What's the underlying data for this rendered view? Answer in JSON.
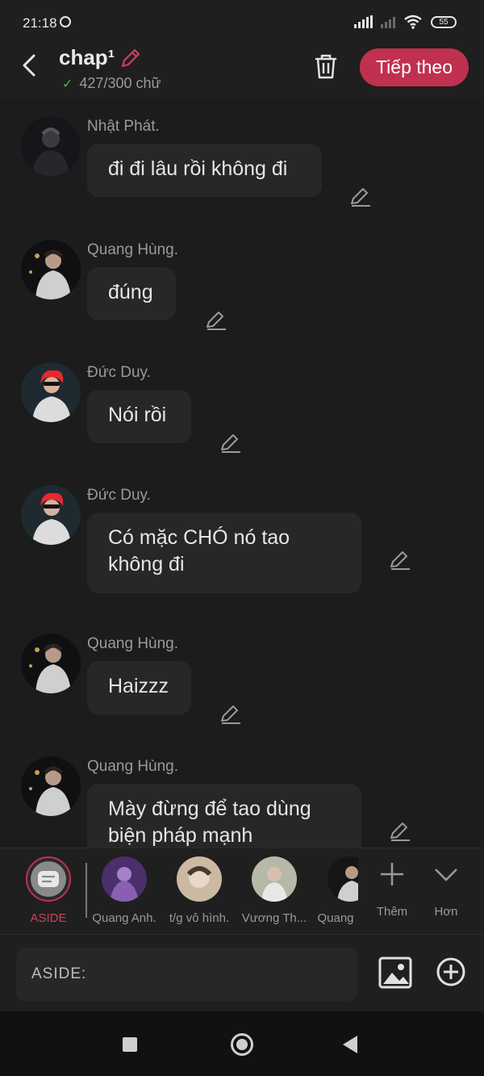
{
  "status": {
    "time": "21:18",
    "battery": "55"
  },
  "header": {
    "title": "chap¹",
    "word_count": "427/300 chữ",
    "next_label": "Tiếp theo"
  },
  "messages": [
    {
      "sender": "Nhật Phát.",
      "text": "đi đi lâu rồi không đi",
      "avatar": "avatar-nhat-phat"
    },
    {
      "sender": "Quang Hùng.",
      "text": "đúng",
      "avatar": "avatar-quang-hung"
    },
    {
      "sender": "Đức Duy.",
      "text": "Nói rồi",
      "avatar": "avatar-duc-duy"
    },
    {
      "sender": "Đức Duy.",
      "text": "Có mặc CHÓ nó tao không đi",
      "avatar": "avatar-duc-duy"
    },
    {
      "sender": "Quang Hùng.",
      "text": "Haizzz",
      "avatar": "avatar-quang-hung"
    },
    {
      "sender": "Quang Hùng.",
      "text": "Mày đừng để tao dùng biện pháp mạnh",
      "avatar": "avatar-quang-hung"
    }
  ],
  "characters": [
    {
      "label": "ASIDE"
    },
    {
      "label": "Quang Anh."
    },
    {
      "label": "t/g vô hình."
    },
    {
      "label": "Vương Th..."
    },
    {
      "label": "Quang"
    }
  ],
  "actions": {
    "more_label": "Thêm",
    "expand_label": "Hơn"
  },
  "input": {
    "label": "ASIDE:"
  },
  "colors": {
    "accent": "#c0314f",
    "background": "#1c1c1c",
    "bubble": "#272727"
  }
}
